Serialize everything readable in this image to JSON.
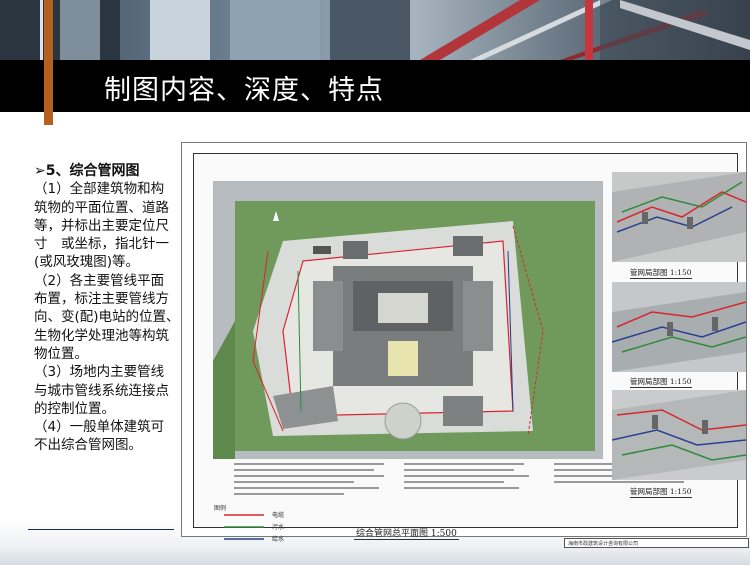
{
  "slide": {
    "title": "制图内容、深度、特点"
  },
  "content": {
    "heading": "➢5、综合管网图",
    "paragraphs": [
      "（1）全部建筑物和构筑物的平面位置、道路等，并标出主要定位尺寸　或坐标，指北针一(或风玫瑰图)等。",
      "（2）各主要管线平面布置，标注主要管线方向、变(配)电站的位置、　生物化学处理池等构筑物位置。",
      "（3）场地内主要管线与城市管线系统连接点的控制位置。",
      "（4）一般单体建筑可不出综合管网图。"
    ]
  },
  "drawing": {
    "plan_caption": "综合管网总平面图  1:500",
    "view_captions": [
      "管网局部图  1:150",
      "管网局部图  1:150",
      "管网局部图  1:150"
    ],
    "legend_title": "图例",
    "legend_items": [
      {
        "label": "电缆",
        "color": "#d8262e"
      },
      {
        "label": "污水",
        "color": "#2f8a3c"
      },
      {
        "label": "给水",
        "color": "#2a3f8f"
      }
    ],
    "title_block": "海南市政建筑设计咨询有限公司"
  }
}
